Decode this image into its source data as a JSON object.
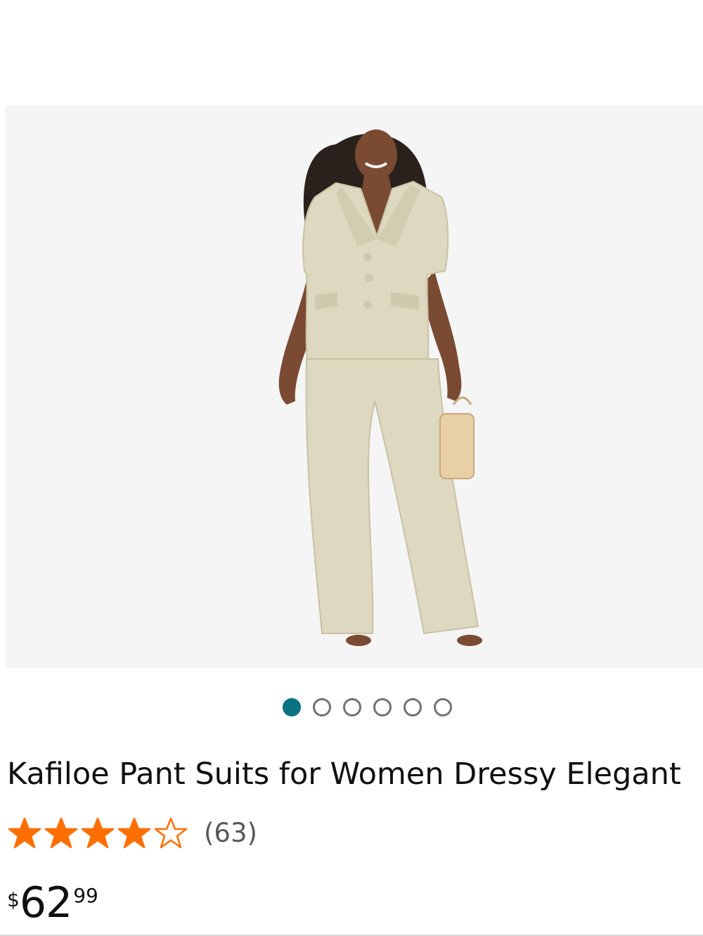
{
  "product": {
    "title": "Kafiloe Pant Suits for Women Dressy Elegant",
    "image": {
      "icon": "product-photo-beige-pant-suit",
      "background": "#f5f5f5",
      "garment_color": "#ddd8bf"
    },
    "carousel": {
      "total": 6,
      "active_index": 0,
      "active_color": "#0a7280"
    },
    "rating": {
      "stars": 4.5,
      "max_stars": 5,
      "count_text": "(63)",
      "star_color": "#ff6f00"
    },
    "price": {
      "symbol": "$",
      "whole": "62",
      "fraction": "99"
    }
  }
}
